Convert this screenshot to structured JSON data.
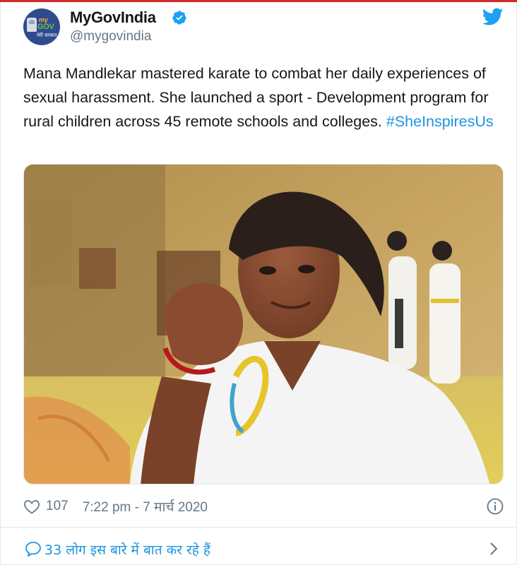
{
  "tweet": {
    "author": {
      "display_name": "MyGovIndia",
      "handle": "@mygovindia",
      "avatar_text_my": "my",
      "avatar_text_gov": "GOV",
      "avatar_text_hi": "मेरी सरकार",
      "verified": true
    },
    "text_main": "Mana Mandlekar mastered karate to combat her daily experiences of sexual harassment. She launched a sport - Development program for rural children across 45 remote schools and colleges. ",
    "hashtag": "#SheInspiresUs",
    "likes": "107",
    "timestamp": "7:22 pm - 7 मार्च 2020",
    "conversation_label": "33 लोग इस बारे में बात कर रहे हैं"
  },
  "colors": {
    "accent": "#1b95e0",
    "muted": "#657786",
    "text": "#14171a",
    "verified": "#1da1f2",
    "top_rule": "#d02a2a"
  },
  "icons": {
    "verified": "verified-badge-icon",
    "brand": "twitter-bird-icon",
    "like": "heart-icon",
    "info": "info-icon",
    "reply": "speech-bubble-icon",
    "more": "chevron-right-icon"
  }
}
